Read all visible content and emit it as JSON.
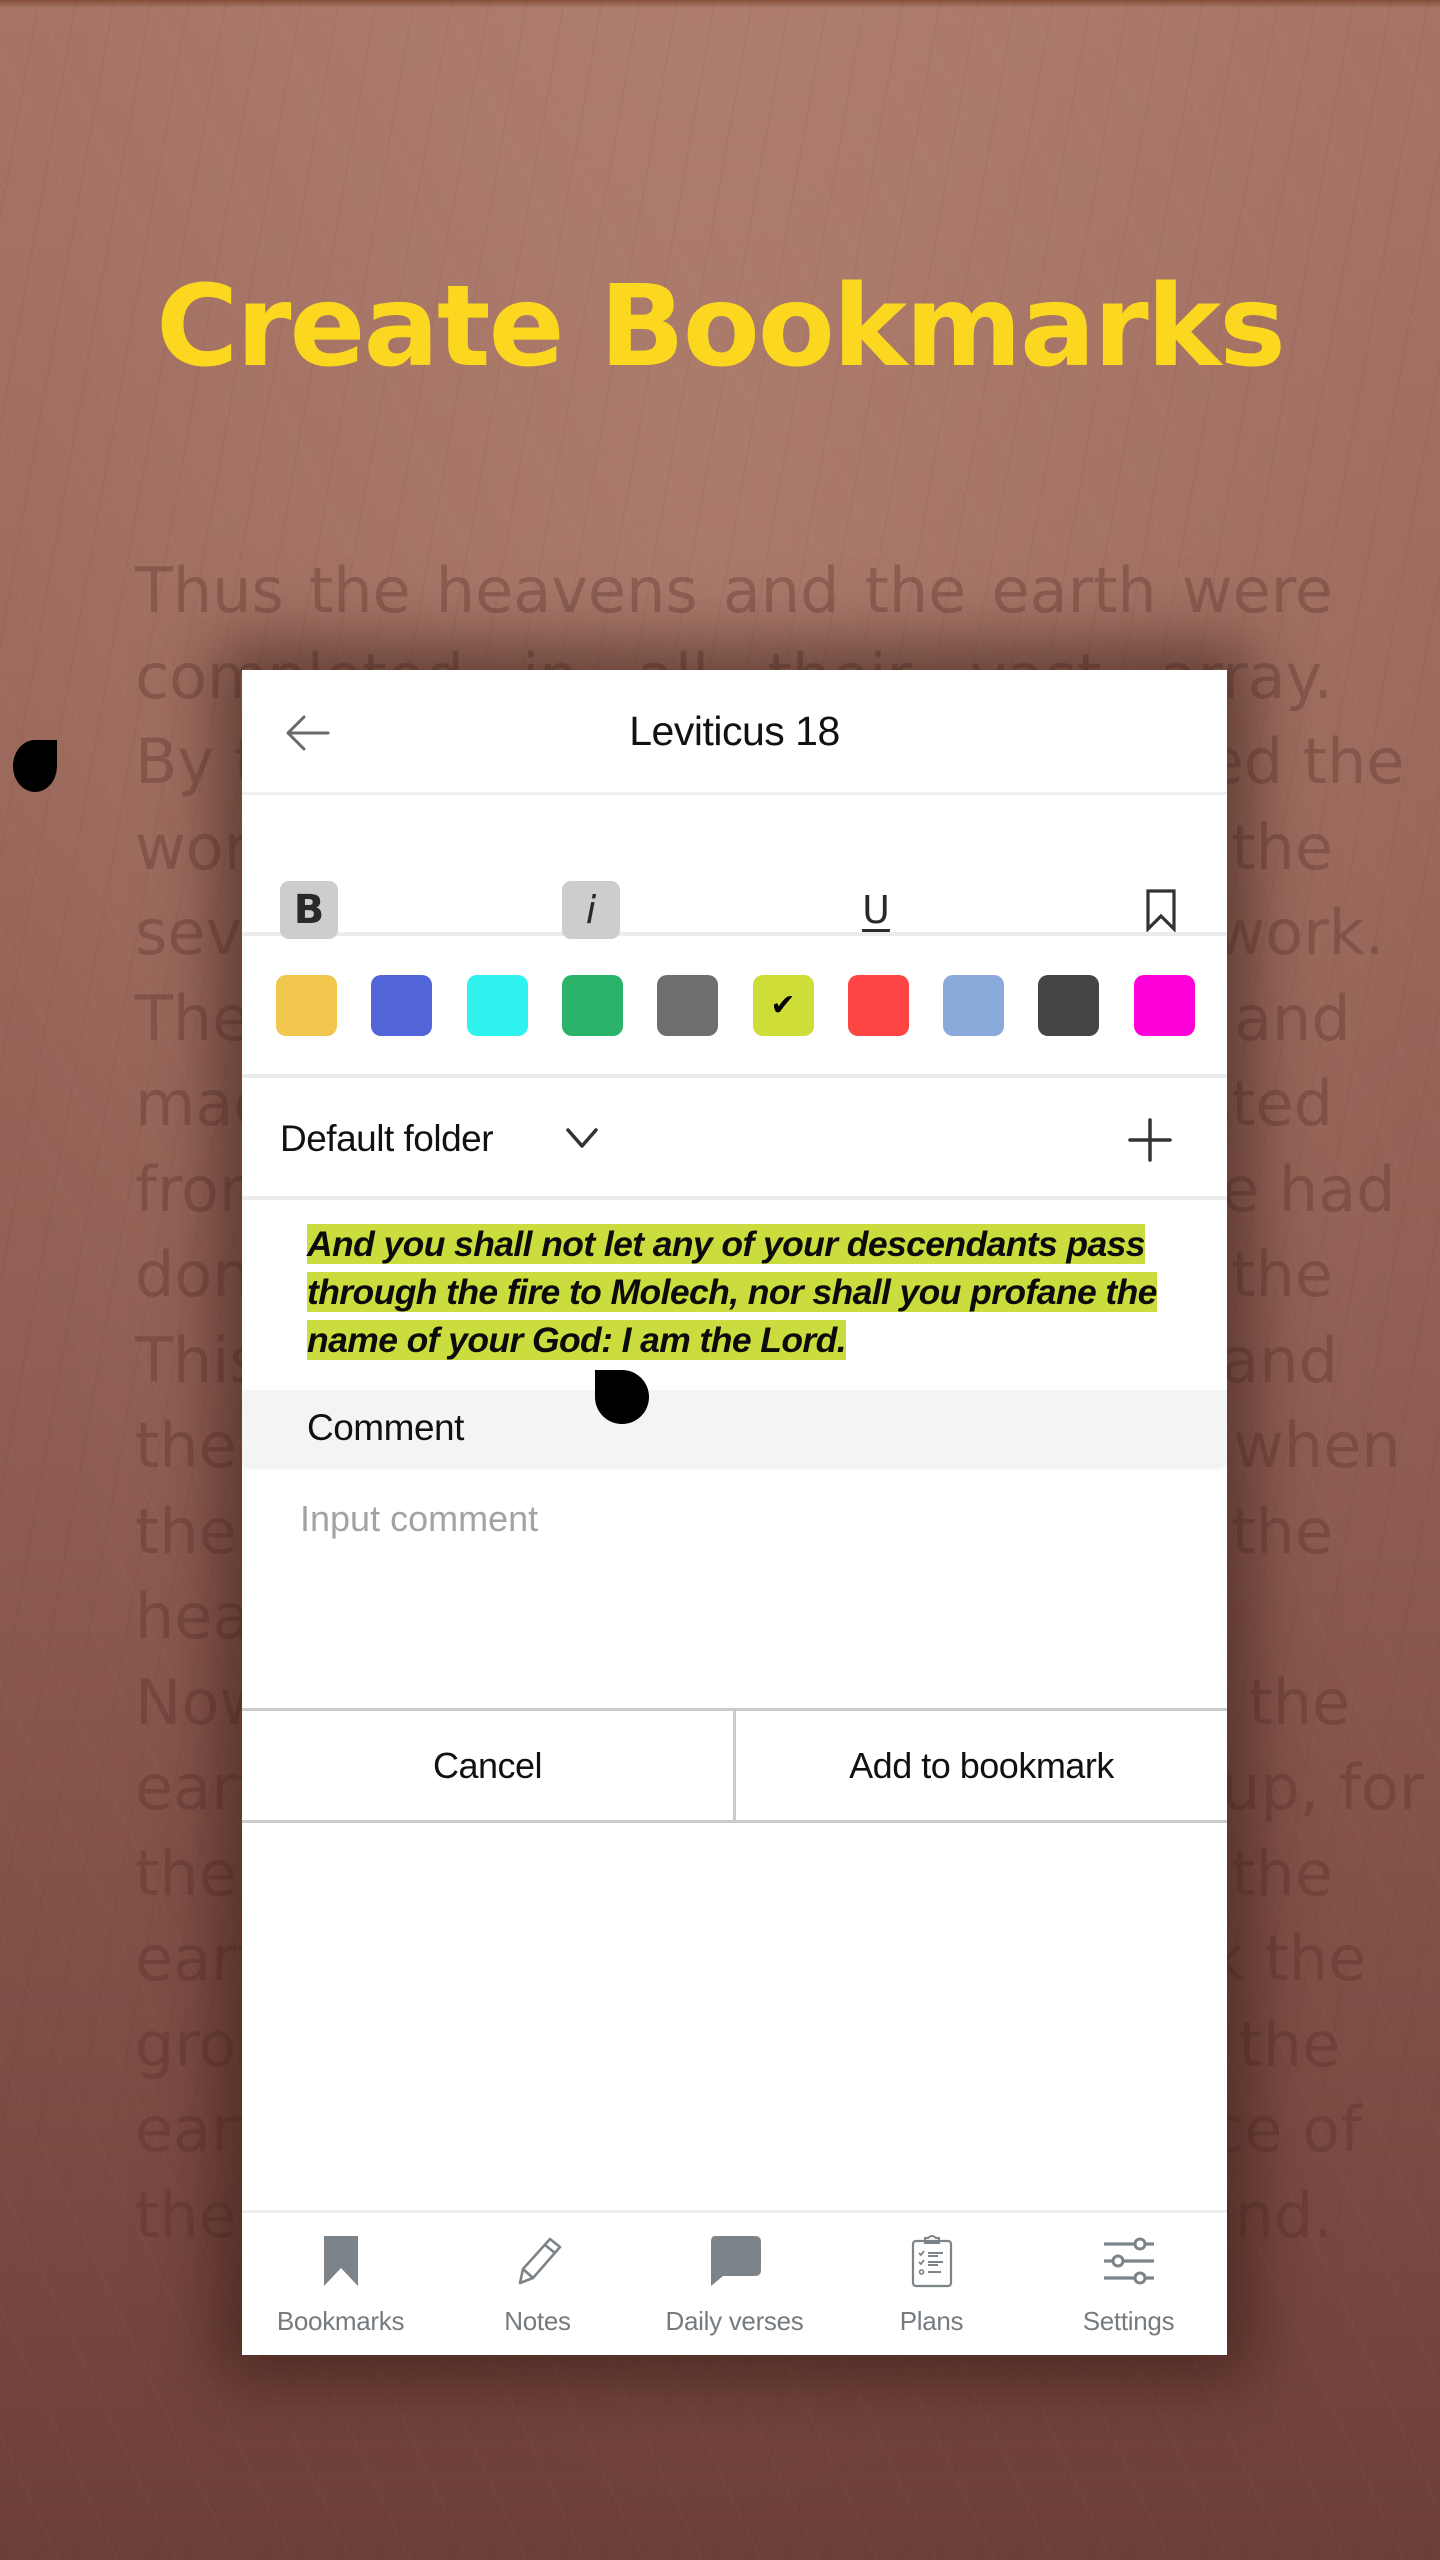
{
  "promo": {
    "headline": "Create Bookmarks",
    "headline_color": "#fbd81f",
    "background_text_lines": [
      "Thus the heavens and the earth were",
      "completed in all their vast array.",
      "By the seventh day God had finished the",
      "work he had been doing; so on the",
      "seventh day he rested from all his work.",
      "Then God blessed the seventh day and",
      "made it holy, because on it he rested",
      "from all the work of creating that he had",
      "done. This is the account of the",
      "This is the account of the heavens and",
      "the earth when they were created, when",
      "the Lord God made the earth and the",
      "heavens.",
      "Now no shrub had yet appeared on the",
      "earth and no plant had yet sprung up, for",
      "the Lord God had not sent rain on the",
      "earth and there was no one to work the",
      "ground, but streams came up from the",
      "earth and watered the whole surface of",
      "the ground."
    ]
  },
  "header": {
    "back_icon": "arrow-left-icon",
    "title": "Leviticus 18"
  },
  "format_toolbar": {
    "bold": {
      "label": "B",
      "active": true
    },
    "italic": {
      "label": "i",
      "active": true
    },
    "underline": {
      "label": "U",
      "active": false
    },
    "bookmark_icon": "bookmark-outline-icon"
  },
  "colors": {
    "swatches": [
      {
        "name": "yellow",
        "hex": "#f2c74e",
        "selected": false
      },
      {
        "name": "blue",
        "hex": "#5165d8",
        "selected": false
      },
      {
        "name": "cyan",
        "hex": "#2ff2ee",
        "selected": false
      },
      {
        "name": "green",
        "hex": "#2bb36a",
        "selected": false
      },
      {
        "name": "gray",
        "hex": "#6e6e6e",
        "selected": false
      },
      {
        "name": "lime",
        "hex": "#cfdd38",
        "selected": true
      },
      {
        "name": "red",
        "hex": "#ff4444",
        "selected": false
      },
      {
        "name": "light-blue",
        "hex": "#8aaadc",
        "selected": false
      },
      {
        "name": "dark-gray",
        "hex": "#444444",
        "selected": false
      },
      {
        "name": "magenta",
        "hex": "#ff00d8",
        "selected": false
      }
    ],
    "check_glyph": "✔"
  },
  "folder": {
    "selected": "Default folder",
    "dropdown_icon": "chevron-down-icon",
    "add_icon": "plus-icon"
  },
  "verse": {
    "text": "And you shall not let any of your descendants pass through the fire to Molech, nor shall you profane the name of your God: I am the Lord.",
    "highlight_color": "#cbdc3e"
  },
  "comment": {
    "label": "Comment",
    "placeholder": "Input comment",
    "value": ""
  },
  "actions": {
    "cancel_label": "Cancel",
    "confirm_label": "Add to bookmark"
  },
  "bottom_nav": {
    "items": [
      {
        "label": "Bookmarks",
        "icon": "bookmark-filled-icon"
      },
      {
        "label": "Notes",
        "icon": "pencil-icon"
      },
      {
        "label": "Daily verses",
        "icon": "speech-bubble-icon"
      },
      {
        "label": "Plans",
        "icon": "clipboard-checklist-icon"
      },
      {
        "label": "Settings",
        "icon": "sliders-icon"
      }
    ]
  }
}
